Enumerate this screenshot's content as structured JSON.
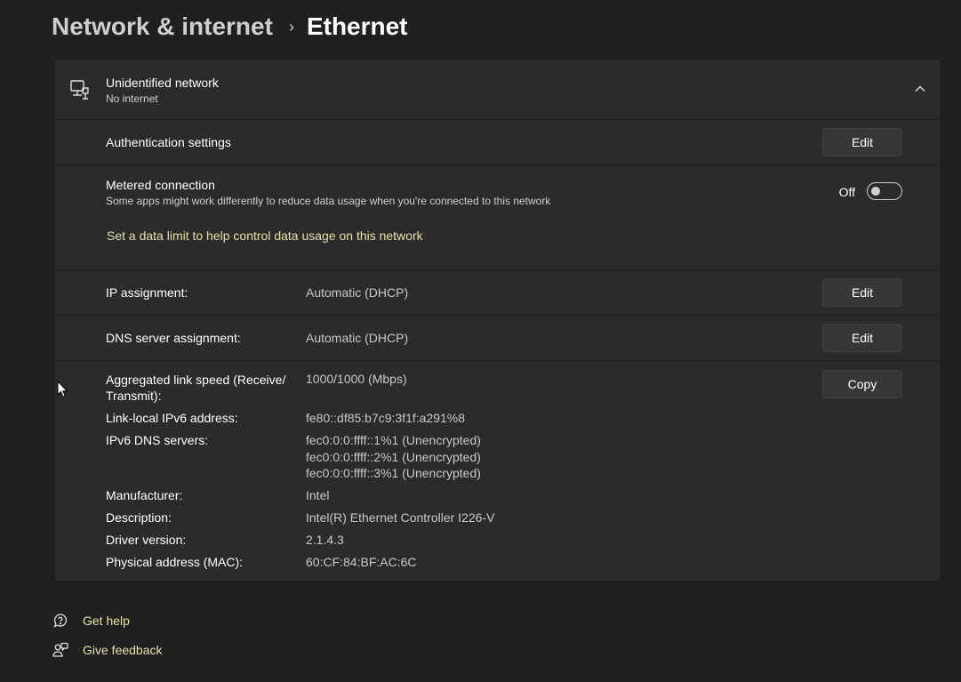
{
  "breadcrumb": {
    "parent": "Network & internet",
    "separator": "›",
    "current": "Ethernet"
  },
  "network": {
    "name": "Unidentified network",
    "status": "No internet",
    "icon": "ethernet-computer-icon",
    "expanded": true
  },
  "authentication": {
    "label": "Authentication settings",
    "button": "Edit"
  },
  "metered": {
    "label": "Metered connection",
    "description": "Some apps might work differently to reduce data usage when you're connected to this network",
    "toggle_state": "Off",
    "link": "Set a data limit to help control data usage on this network"
  },
  "ip": {
    "label": "IP assignment:",
    "value": "Automatic (DHCP)",
    "button": "Edit"
  },
  "dns": {
    "label": "DNS server assignment:",
    "value": "Automatic (DHCP)",
    "button": "Edit"
  },
  "properties": {
    "copy_button": "Copy",
    "link_speed_label_1": "Aggregated link speed (Receive/",
    "link_speed_label_2": "Transmit):",
    "link_speed_value": "1000/1000 (Mbps)",
    "ipv6_label": "Link-local IPv6 address:",
    "ipv6_value": "fe80::df85:b7c9:3f1f:a291%8",
    "ipv6_dns_label": "IPv6 DNS servers:",
    "ipv6_dns_values": [
      "fec0:0:0:ffff::1%1 (Unencrypted)",
      "fec0:0:0:ffff::2%1 (Unencrypted)",
      "fec0:0:0:ffff::3%1 (Unencrypted)"
    ],
    "manufacturer_label": "Manufacturer:",
    "manufacturer_value": "Intel",
    "description_label": "Description:",
    "description_value": "Intel(R) Ethernet Controller I226-V",
    "driver_label": "Driver version:",
    "driver_value": "2.1.4.3",
    "mac_label": "Physical address (MAC):",
    "mac_value": "60:CF:84:BF:AC:6C"
  },
  "footer": {
    "help": "Get help",
    "feedback": "Give feedback"
  },
  "colors": {
    "background": "#202020",
    "card": "#2b2b2b",
    "link": "#e6e0a8",
    "button": "#373737"
  }
}
